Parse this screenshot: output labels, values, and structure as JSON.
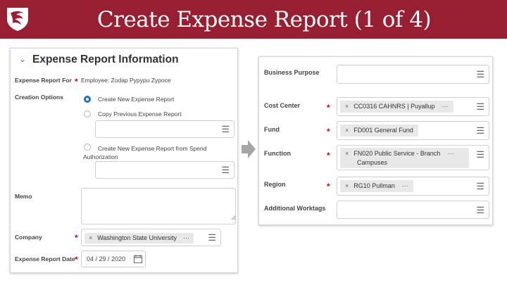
{
  "header": {
    "title": "Create Expense Report (1 of 4)",
    "logo_icon": "wsu-cougar-logo",
    "bg_color": "#981e32"
  },
  "left_panel": {
    "section_title": "Expense Report Information",
    "expense_report_for": {
      "label": "Expense Report For",
      "value": "Employee: Zodap Pypypu Zypoce"
    },
    "creation_options": {
      "label": "Creation Options",
      "options": [
        {
          "label": "Create New Expense Report",
          "selected": true
        },
        {
          "label": "Copy Previous Expense Report",
          "selected": false
        },
        {
          "label": "Create New Expense Report from Spend Authorization",
          "selected": false
        }
      ]
    },
    "memo": {
      "label": "Memo",
      "value": ""
    },
    "company": {
      "label": "Company",
      "value": "Washington State University"
    },
    "expense_report_date": {
      "label": "Expense Report Date",
      "value": "04 / 29 / 2020"
    }
  },
  "right_panel": {
    "business_purpose": {
      "label": "Business Purpose",
      "value": ""
    },
    "cost_center": {
      "label": "Cost Center",
      "value": "CC0316 CAHNRS | Puyallup"
    },
    "fund": {
      "label": "Fund",
      "value": "FD001 General Fund"
    },
    "function": {
      "label": "Function",
      "value_line1": "FN020 Public Service - Branch",
      "value_line2": "Campuses"
    },
    "region": {
      "label": "Region",
      "value": "RG10 Pullman"
    },
    "additional_worktags": {
      "label": "Additional Worktags",
      "value": ""
    }
  },
  "icons": {
    "remove": "×",
    "more": "···",
    "required": "*",
    "menu": "☰"
  }
}
